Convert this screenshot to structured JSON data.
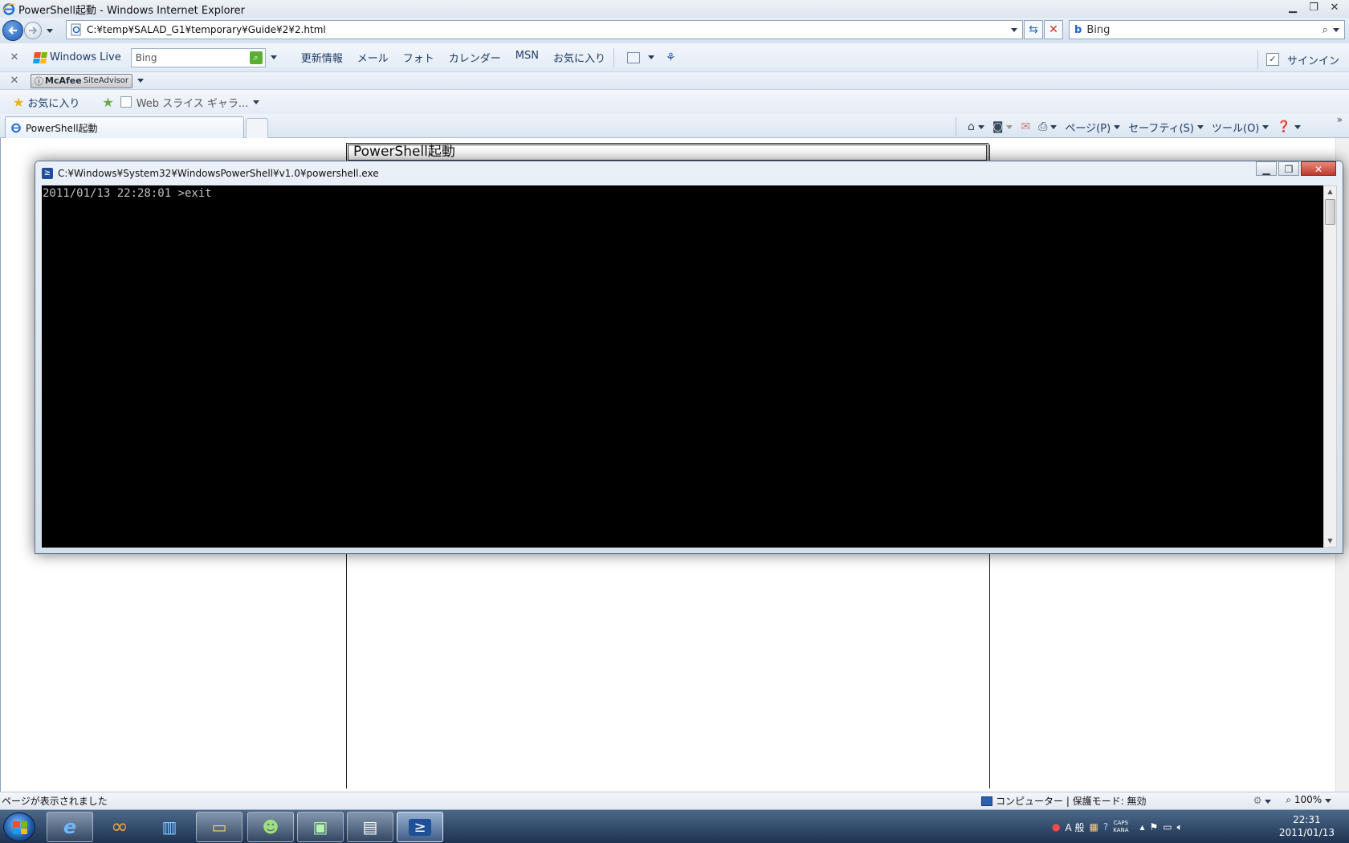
{
  "ie": {
    "window_title": "PowerShell起動 - Windows Internet Explorer",
    "address": "C:¥temp¥SALAD_G1¥temporary¥Guide¥2¥2.html",
    "search_placeholder": "Bing",
    "search_logo": "b"
  },
  "live_toolbar": {
    "brand": "Windows Live",
    "search_placeholder": "Bing",
    "menu": [
      "更新情報",
      "メール",
      "フォト",
      "カレンダー",
      "MSN",
      "お気に入り"
    ],
    "signin": "サインイン"
  },
  "mcafee": {
    "brand": "McAfee",
    "product": "SiteAdvisor"
  },
  "favorites": {
    "label": "お気に入り",
    "webslice": "Web スライス ギャラ..."
  },
  "tab": {
    "label": "PowerShell起動"
  },
  "commandbar": {
    "page": "ページ(P)",
    "safety": "セーフティ(S)",
    "tools": "ツール(O)"
  },
  "page": {
    "heading": "PowerShell起動"
  },
  "powershell": {
    "title": "C:¥Windows¥System32¥WindowsPowerShell¥v1.0¥powershell.exe",
    "console_text": "2011/01/13 22:28:01 >exit"
  },
  "statusbar": {
    "left": "ページが表示されました",
    "zone": "コンピューター | 保護モード: 無効",
    "zoom": "100%"
  },
  "tray": {
    "ime_mode": "A 般",
    "caps": "CAPS",
    "kana": "KANA"
  },
  "clock": {
    "time": "22:31",
    "date": "2011/01/13"
  },
  "colors": {
    "console_bg": "#000000",
    "console_fg": "#c0c0c0",
    "taskbar": "#1e3352"
  },
  "icons": [
    "ie-icon",
    "back-arrow-icon",
    "forward-arrow-icon",
    "refresh-icon",
    "stop-icon",
    "search-icon",
    "windows-live-flag-icon",
    "rss-icon",
    "home-icon",
    "print-icon",
    "help-icon",
    "star-icon",
    "powershell-icon",
    "windows-start-icon"
  ]
}
